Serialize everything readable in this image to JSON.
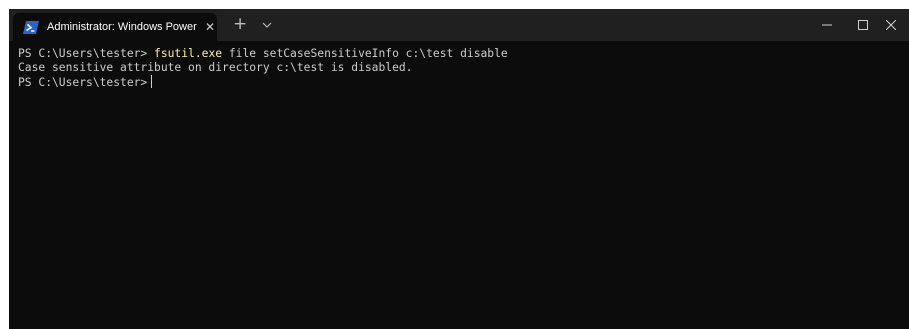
{
  "window": {
    "tab_title": "Administrator: Windows PowerS",
    "tab_close_glyph": "✕",
    "new_tab_glyph": "+",
    "icons": {
      "tab": "powershell-icon",
      "dropdown": "chevron-down-icon",
      "minimize": "minimize-icon",
      "maximize": "maximize-icon",
      "close": "close-icon"
    }
  },
  "terminal": {
    "line1": {
      "prompt": "PS C:\\Users\\tester> ",
      "command": "fsutil.exe",
      "args": " file setCaseSensitiveInfo c:\\test disable"
    },
    "line2": "Case sensitive attribute on directory c:\\test is disabled.",
    "line3": {
      "prompt": "PS C:\\Users\\tester>"
    }
  },
  "colors": {
    "terminal_bg": "#0c0c0c",
    "titlebar_bg": "#202020",
    "text": "#cccccc",
    "command_highlight": "#f9f1a5",
    "powershell_icon": "#2a64c8"
  }
}
